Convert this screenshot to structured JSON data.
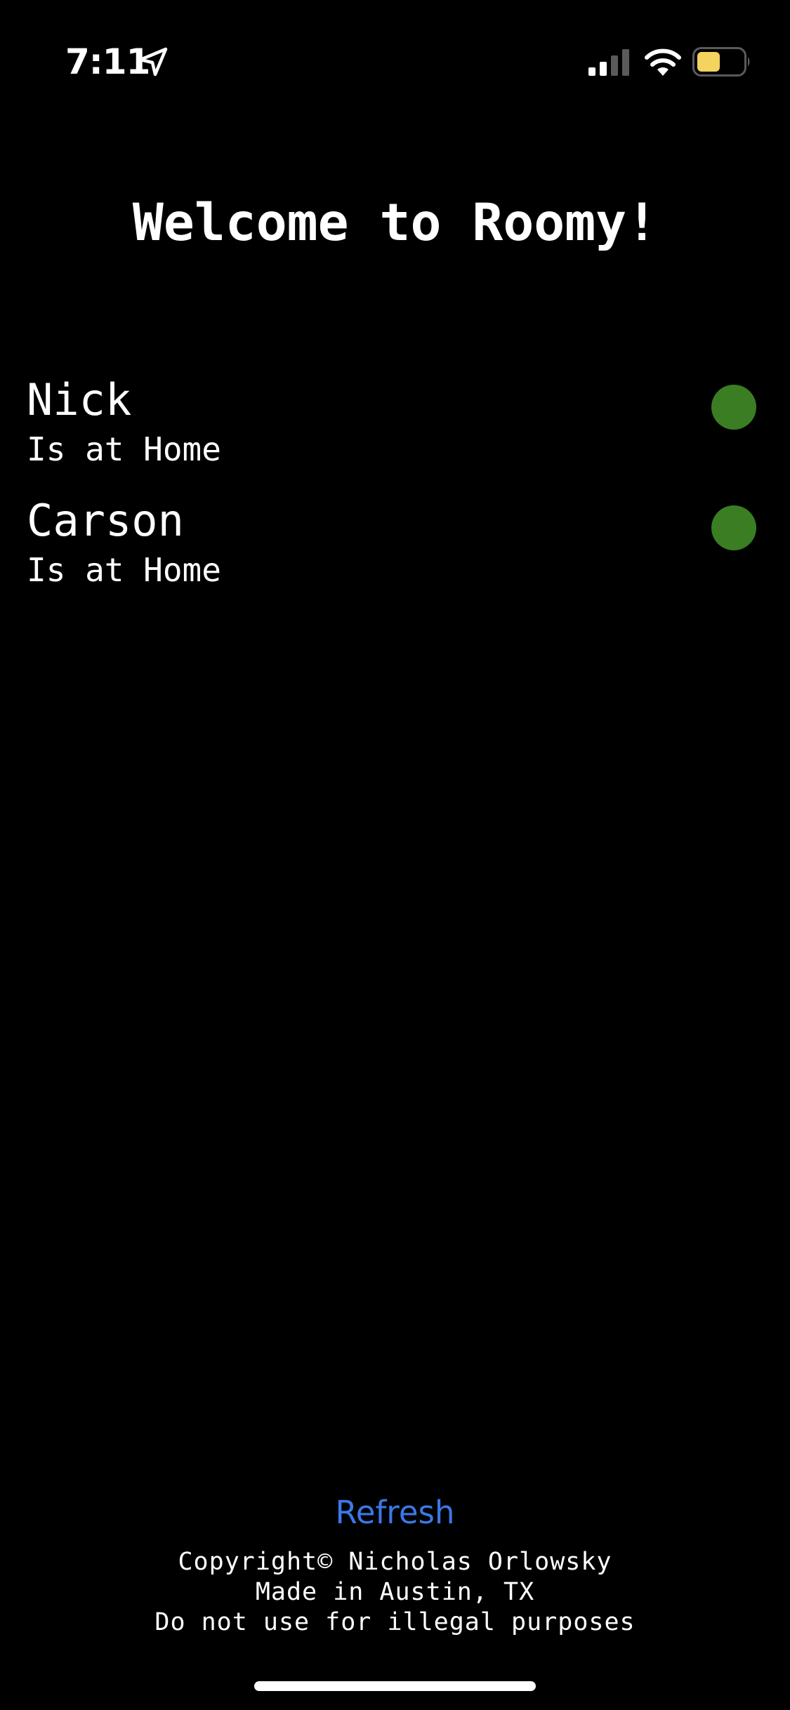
{
  "status_bar": {
    "time": "7:11",
    "icons": [
      "location-arrow-icon",
      "cellular-signal-icon",
      "wifi-icon",
      "battery-icon"
    ],
    "battery_color": "#f4d35e"
  },
  "title": "Welcome to Roomy!",
  "roommates": [
    {
      "name": "Nick",
      "status": "Is at Home",
      "indicator_color": "#3a7d23"
    },
    {
      "name": "Carson",
      "status": "Is at Home",
      "indicator_color": "#3a7d23"
    }
  ],
  "refresh_label": "Refresh",
  "accent_color": "#3b78e7",
  "footer": {
    "copyright": "Copyright© Nicholas Orlowsky",
    "made_in": "Made in Austin, TX",
    "disclaimer": "Do not use for illegal purposes"
  }
}
